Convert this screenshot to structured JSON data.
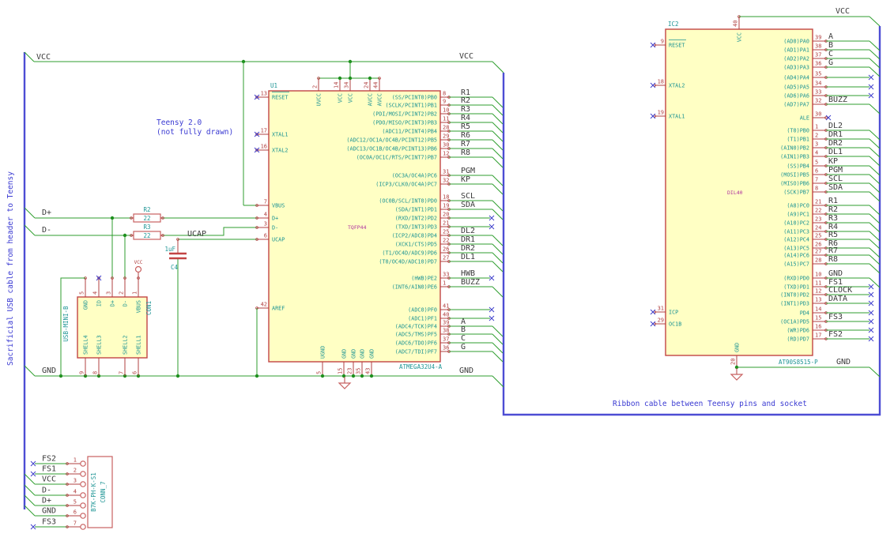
{
  "notes": {
    "left_cable": "Sacrificial USB cable from header to Teensy",
    "teensy_1": "Teensy 2.0",
    "teensy_2": "(not fully drawn)",
    "ribbon": "Ribbon cable between Teensy pins and socket"
  },
  "rails": {
    "vcc_left": "VCC",
    "vcc_right_of_u1": "VCC",
    "gnd_left": "GND",
    "gnd_right_of_u1": "GND",
    "dplus": "D+",
    "dminus": "D-",
    "ucap": "UCAP",
    "vcc_ic2": "VCC",
    "gnd_ic2": "GND",
    "vcc_symbol": "VCC"
  },
  "u1": {
    "ref": "U1",
    "value": "ATMEGA32U4-A",
    "package": "TQFP44",
    "left_pins": [
      {
        "num": "13",
        "name": "RESET",
        "nc": true,
        "overline": true
      },
      {
        "num": "17",
        "name": "XTAL1",
        "nc": true
      },
      {
        "num": "16",
        "name": "XTAL2",
        "nc": true
      },
      {
        "num": "7",
        "name": "VBUS"
      },
      {
        "num": "4",
        "name": "D+"
      },
      {
        "num": "3",
        "name": "D-"
      },
      {
        "num": "6",
        "name": "UCAP"
      },
      {
        "num": "42",
        "name": "AREF"
      }
    ],
    "top_pins": [
      {
        "num": "2",
        "name": "UVCC"
      },
      {
        "num": "14",
        "name": "VCC"
      },
      {
        "num": "34",
        "name": "VCC"
      },
      {
        "num": "24",
        "name": "AVCC"
      },
      {
        "num": "44",
        "name": "AVCC"
      }
    ],
    "bottom_pins": [
      {
        "num": "5",
        "name": "UGND"
      },
      {
        "num": "15",
        "name": "GND"
      },
      {
        "num": "23",
        "name": "GND"
      },
      {
        "num": "35",
        "name": "GND"
      },
      {
        "num": "43",
        "name": "GND"
      }
    ],
    "right_pins": [
      {
        "num": "8",
        "name": "(SS/PCINT0)PB0",
        "net": "R1",
        "conn": "bus"
      },
      {
        "num": "9",
        "name": "(SCLK/PCINT1)PB1",
        "net": "R2",
        "conn": "bus"
      },
      {
        "num": "10",
        "name": "(PDI/MOSI/PCINT2)PB2",
        "net": "R3",
        "conn": "bus"
      },
      {
        "num": "11",
        "name": "(PDO/MISO/PCINT3)PB3",
        "net": "R4",
        "conn": "bus"
      },
      {
        "num": "28",
        "name": "(ADC11/PCINT4)PB4",
        "net": "R5",
        "conn": "bus"
      },
      {
        "num": "29",
        "name": "(ADC12/OC1A/OC4B/PCINT12)PB5",
        "net": "R6",
        "conn": "bus"
      },
      {
        "num": "30",
        "name": "(ADC13/OC1B/OC4B/PCINT13)PB6",
        "net": "R7",
        "conn": "bus"
      },
      {
        "num": "12",
        "name": "(OC0A/OC1C/RTS/PCINT7)PB7",
        "net": "R8",
        "conn": "bus"
      },
      {
        "num": "31",
        "name": "(OC3A/OC4A)PC6",
        "net": "PGM",
        "conn": "bus"
      },
      {
        "num": "32",
        "name": "(ICP3/CLK0/OC4A)PC7",
        "net": "KP",
        "conn": "bus"
      },
      {
        "num": "18",
        "name": "(OC0B/SCL/INT0)PD0",
        "net": "SCL",
        "conn": "bus"
      },
      {
        "num": "19",
        "name": "(SDA/INT1)PD1",
        "net": "SDA",
        "conn": "bus"
      },
      {
        "num": "20",
        "name": "(RXD/INT2)PD2",
        "net": "",
        "conn": "nc"
      },
      {
        "num": "21",
        "name": "(TXD/INT3)PD3",
        "net": "",
        "conn": "nc"
      },
      {
        "num": "25",
        "name": "(ICP2/ADC8)PD4",
        "net": "DL2",
        "conn": "bus"
      },
      {
        "num": "22",
        "name": "(XCK1/CTS)PD5",
        "net": "DR1",
        "conn": "bus"
      },
      {
        "num": "26",
        "name": "(T1/OC4D/ADC9)PD6",
        "net": "DR2",
        "conn": "bus"
      },
      {
        "num": "27",
        "name": "(T0/OC4D/ADC10)PD7",
        "net": "DL1",
        "conn": "bus"
      },
      {
        "num": "33",
        "name": "(HWB)PE2",
        "net": "HWB",
        "conn": "nc"
      },
      {
        "num": "1",
        "name": "(INT6/AIN0)PE6",
        "net": "BUZZ",
        "conn": "bus"
      },
      {
        "num": "41",
        "name": "(ADC0)PF0",
        "net": "",
        "conn": "nc"
      },
      {
        "num": "40",
        "name": "(ADC1)PF1",
        "net": "",
        "conn": "nc"
      },
      {
        "num": "39",
        "name": "(ADC4/TCK)PF4",
        "net": "A",
        "conn": "bus"
      },
      {
        "num": "38",
        "name": "(ADC5/TMS)PF5",
        "net": "B",
        "conn": "bus"
      },
      {
        "num": "37",
        "name": "(ADC6/TDO)PF6",
        "net": "C",
        "conn": "bus"
      },
      {
        "num": "36",
        "name": "(ADC7/TDI)PF7",
        "net": "G",
        "conn": "bus"
      }
    ]
  },
  "ic2": {
    "ref": "IC2",
    "value": "AT90S8515-P",
    "package": "DIL40",
    "left_pins": [
      {
        "num": "9",
        "name": "RESET",
        "nc": true,
        "overline": true
      },
      {
        "num": "18",
        "name": "XTAL2",
        "nc": true
      },
      {
        "num": "19",
        "name": "XTAL1",
        "nc": true
      },
      {
        "num": "31",
        "name": "ICP",
        "nc": true
      },
      {
        "num": "29",
        "name": "OC1B",
        "nc": true
      }
    ],
    "top_pins": [
      {
        "num": "40",
        "name": "VCC"
      }
    ],
    "bottom_pins": [
      {
        "num": "20",
        "name": "GND"
      }
    ],
    "right_pins": [
      {
        "num": "39",
        "name": "(AD0)PA0",
        "net": "A",
        "conn": "bus"
      },
      {
        "num": "38",
        "name": "(AD1)PA1",
        "net": "B",
        "conn": "bus"
      },
      {
        "num": "37",
        "name": "(AD2)PA2",
        "net": "C",
        "conn": "bus"
      },
      {
        "num": "36",
        "name": "(AD3)PA3",
        "net": "G",
        "conn": "bus"
      },
      {
        "num": "35",
        "name": "(AD4)PA4",
        "net": "",
        "conn": "nc"
      },
      {
        "num": "34",
        "name": "(AD5)PA5",
        "net": "",
        "conn": "nc"
      },
      {
        "num": "33",
        "name": "(AD6)PA6",
        "net": "",
        "conn": "nc"
      },
      {
        "num": "32",
        "name": "(AD7)PA7",
        "net": "BUZZ",
        "conn": "bus"
      },
      {
        "num": "30",
        "name": "ALE",
        "net": "",
        "conn": "ncpin"
      },
      {
        "num": "1",
        "name": "(T0)PB0",
        "net": "DL2",
        "conn": "bus"
      },
      {
        "num": "2",
        "name": "(T1)PB1",
        "net": "DR1",
        "conn": "bus"
      },
      {
        "num": "3",
        "name": "(AIN0)PB2",
        "net": "DR2",
        "conn": "bus"
      },
      {
        "num": "4",
        "name": "(AIN1)PB3",
        "net": "DL1",
        "conn": "bus"
      },
      {
        "num": "5",
        "name": "(SS)PB4",
        "net": "KP",
        "conn": "bus"
      },
      {
        "num": "6",
        "name": "(MOSI)PB5",
        "net": "PGM",
        "conn": "bus"
      },
      {
        "num": "7",
        "name": "(MISO)PB6",
        "net": "SCL",
        "conn": "bus"
      },
      {
        "num": "8",
        "name": "(SCK)PB7",
        "net": "SDA",
        "conn": "bus"
      },
      {
        "num": "21",
        "name": "(A8)PC0",
        "net": "R1",
        "conn": "bus"
      },
      {
        "num": "22",
        "name": "(A9)PC1",
        "net": "R2",
        "conn": "bus"
      },
      {
        "num": "23",
        "name": "(A10)PC2",
        "net": "R3",
        "conn": "bus"
      },
      {
        "num": "24",
        "name": "(A11)PC3",
        "net": "R4",
        "conn": "bus"
      },
      {
        "num": "25",
        "name": "(A12)PC4",
        "net": "R5",
        "conn": "bus"
      },
      {
        "num": "26",
        "name": "(A13)PC5",
        "net": "R6",
        "conn": "bus"
      },
      {
        "num": "27",
        "name": "(A14)PC6",
        "net": "R7",
        "conn": "bus"
      },
      {
        "num": "28",
        "name": "(A15)PC7",
        "net": "R8",
        "conn": "bus"
      },
      {
        "num": "10",
        "name": "(RXD)PD0",
        "net": "GND",
        "conn": "bus"
      },
      {
        "num": "11",
        "name": "(TXD)PD1",
        "net": "FS1",
        "conn": "nc"
      },
      {
        "num": "12",
        "name": "(INT0)PD2",
        "net": "CLOCK",
        "conn": "nc"
      },
      {
        "num": "13",
        "name": "(INT1)PD3",
        "net": "DATA",
        "conn": "nc"
      },
      {
        "num": "14",
        "name": "PD4",
        "net": "",
        "conn": "nc"
      },
      {
        "num": "15",
        "name": "(OC1A)PD5",
        "net": "FS3",
        "conn": "nc"
      },
      {
        "num": "16",
        "name": "(WR)PD6",
        "net": "",
        "conn": "nc"
      },
      {
        "num": "17",
        "name": "(RD)PD7",
        "net": "FS2",
        "conn": "nc"
      }
    ]
  },
  "con1": {
    "ref": "CON1",
    "value": "USB-MINI-B",
    "top_pins": [
      {
        "num": "5",
        "name": "GND"
      },
      {
        "num": "4",
        "name": "ID",
        "nc": true
      },
      {
        "num": "3",
        "name": "D+"
      },
      {
        "num": "2",
        "name": "D-"
      },
      {
        "num": "1",
        "name": "VBUS"
      }
    ],
    "bottom_pins": [
      {
        "num": "9",
        "name": "SHELL4"
      },
      {
        "num": "8",
        "name": "SHELL3"
      },
      {
        "num": "7",
        "name": "SHELL2"
      },
      {
        "num": "6",
        "name": "SHELL1"
      }
    ]
  },
  "conn7": {
    "ref": "CONN_7",
    "value": "B7K-PH-K-S1",
    "pins": [
      {
        "num": "1",
        "label": "FS2",
        "nc": true
      },
      {
        "num": "2",
        "label": "FS1",
        "nc": true
      },
      {
        "num": "3",
        "label": "VCC"
      },
      {
        "num": "4",
        "label": "D-"
      },
      {
        "num": "5",
        "label": "D+"
      },
      {
        "num": "6",
        "label": "GND"
      },
      {
        "num": "7",
        "label": "FS3",
        "nc": true
      }
    ]
  },
  "r2": {
    "ref": "R2",
    "value": "22"
  },
  "r3": {
    "ref": "R3",
    "value": "22"
  },
  "c4": {
    "ref": "C4",
    "value": "1uF"
  },
  "colors": {
    "wire": "#2f9e2f",
    "bus": "#4d4dd4",
    "symbol_outline": "#c24444",
    "symbol_fill": "#ffffc4",
    "pin_name": "#1d9494",
    "pin_number": "#b04040",
    "net_label": "#3a3a3a",
    "note": "#3a3ad2",
    "no_connect": "#4040cc",
    "package_text": "#b034a0"
  }
}
